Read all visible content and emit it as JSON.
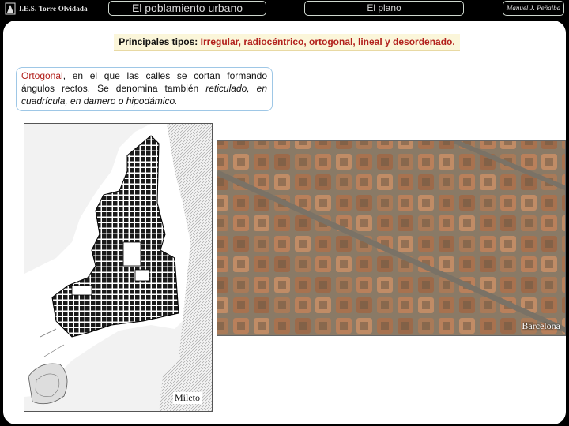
{
  "header": {
    "school": "I.E.S. Torre Olvidada",
    "title": "El poblamiento urbano",
    "section": "El plano",
    "author": "Manuel J. Peñalba"
  },
  "types": {
    "label": "Principales tipos:",
    "list": "Irregular, radiocéntrico, ortogonal, lineal y desordenado."
  },
  "definition": {
    "term": "Ortogonal",
    "text_1": ",  en el que las calles se cortan formando ángulos rectos. Se denomina también ",
    "italic": "reticulado, en cuadrícula, en damero o hipodámico."
  },
  "images": {
    "mileto_caption": "Mileto",
    "barcelona_caption": "Barcelona"
  },
  "colors": {
    "accent_red": "#b2201c",
    "box_border": "#9ec7e6",
    "types_bg": "#fbf6da"
  }
}
